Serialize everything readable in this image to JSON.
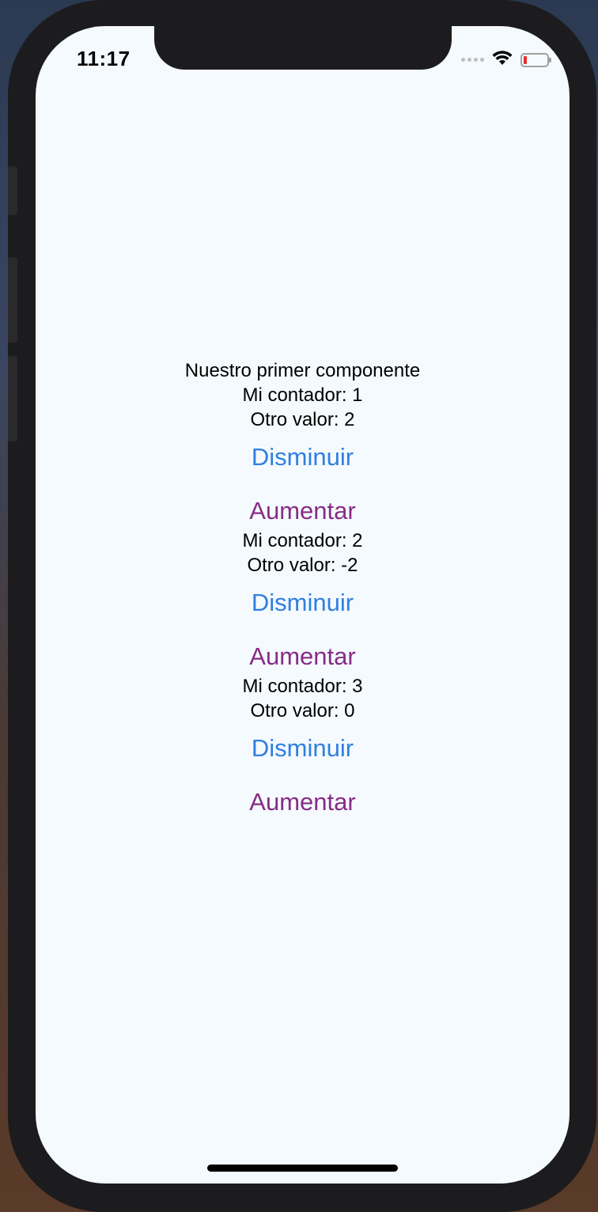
{
  "status_bar": {
    "time": "11:17"
  },
  "component": {
    "title": "Nuestro primer componente"
  },
  "counters": [
    {
      "counter_label": "Mi contador: 1",
      "other_label": "Otro valor: 2",
      "decrease_label": "Disminuir",
      "increase_label": "Aumentar"
    },
    {
      "counter_label": "Mi contador: 2",
      "other_label": "Otro valor: -2",
      "decrease_label": "Disminuir",
      "increase_label": "Aumentar"
    },
    {
      "counter_label": "Mi contador: 3",
      "other_label": "Otro valor: 0",
      "decrease_label": "Disminuir",
      "increase_label": "Aumentar"
    }
  ],
  "colors": {
    "decrease_button": "#2f7fe0",
    "increase_button": "#872c86",
    "screen_background": "#f5faff"
  }
}
